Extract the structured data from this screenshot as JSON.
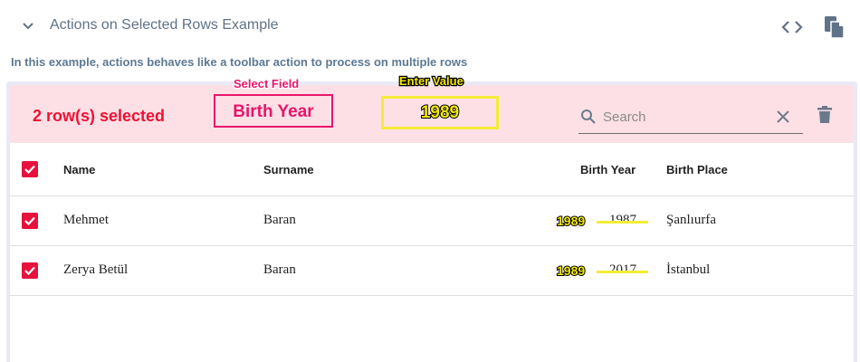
{
  "header": {
    "title": "Actions on Selected Rows Example",
    "icons": [
      "chevron-down-icon",
      "code-icon",
      "copy-icon"
    ]
  },
  "description": "In this example, actions behaves like a toolbar action to process on multiple rows",
  "toolbar": {
    "selected_text": "2 row(s) selected",
    "select_field_label": "Select Field",
    "select_field_value": "Birth Year",
    "enter_value_label": "Enter Value",
    "enter_value_value": "1989",
    "search_placeholder": "Search",
    "search_value": ""
  },
  "table": {
    "columns": [
      "Name",
      "Surname",
      "Birth Year",
      "Birth Place"
    ],
    "rows": [
      {
        "name": "Mehmet",
        "surname": "Baran",
        "birth_year_old": "1987",
        "birth_year_new": "1989",
        "birth_place": "Şanlıurfa"
      },
      {
        "name": "Zerya Betül",
        "surname": "Baran",
        "birth_year_old": "2017",
        "birth_year_new": "1989",
        "birth_place": "İstanbul"
      }
    ]
  },
  "colors": {
    "accent": "#e8113c",
    "toolbar_bg": "#fde0e6",
    "annotation_pink": "#e8156a",
    "annotation_yellow": "#f3ec37",
    "header_text": "#5f7288"
  }
}
